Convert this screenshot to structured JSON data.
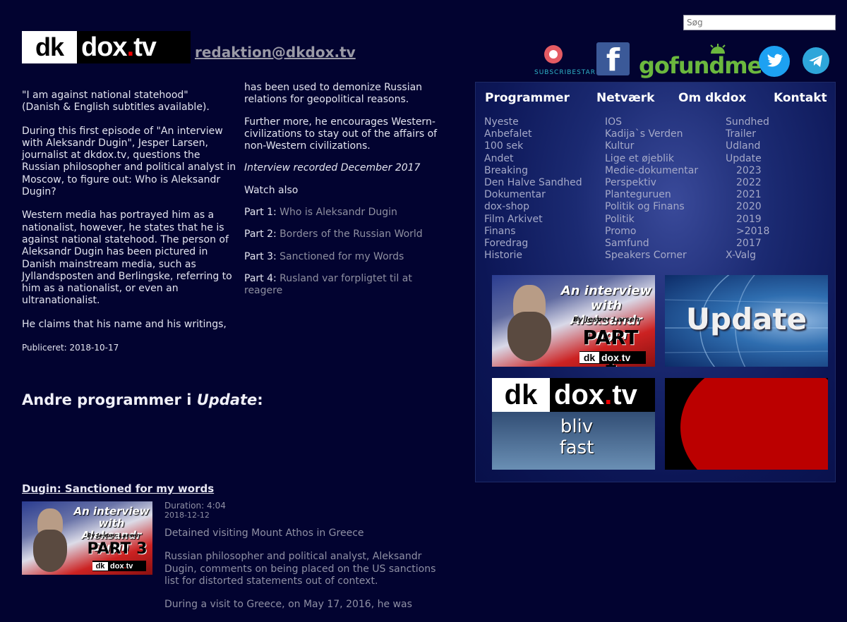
{
  "search": {
    "placeholder": "Søg"
  },
  "header": {
    "logo_dk": "dk",
    "logo_dox": "dox",
    "logo_dot": ".",
    "logo_tv": "tv",
    "email": "redaktion@dkdox.tv"
  },
  "social": {
    "subscribestar_label": "SUBSCRIBESTAR",
    "facebook_glyph": "f",
    "gofundme_label": "gofundme",
    "twitter_icon": "twitter-icon",
    "telegram_icon": "telegram-icon"
  },
  "article": {
    "col1": [
      "\"I am against national statehood\"\n(Danish & English subtitles available).",
      "During this first episode of \"An interview with Aleksandr Dugin\", Jesper Larsen, journalist at dkdox.tv, questions the Russian philosopher and political analyst in Moscow, to figure out: Who is Aleksandr Dugin?",
      "Western media has portrayed him as a nationalist, however, he states that he is against national statehood. The person of Aleksandr Dugin has been pictured in Danish mainstream media, such as Jyllandsposten and Berlingske, referring to him as a nationalist, or even an ultranationalist.",
      "He claims that his name and his writings,"
    ],
    "published": "Publiceret: 2018-10-17",
    "col2_p1": "has been used to demonize Russian relations for geopolitical reasons.",
    "col2_p2": "Further more, he encourages Western-civilizations to stay out of the affairs of non-Western civilizations.",
    "recorded": "Interview recorded December 2017",
    "watch_also": "Watch also",
    "parts": [
      {
        "prefix": "Part 1: ",
        "link": "Who is Aleksandr Dugin"
      },
      {
        "prefix": "Part 2: ",
        "link": "Borders of the Russian World"
      },
      {
        "prefix": "Part 3: ",
        "link": "Sanctioned for my Words"
      },
      {
        "prefix": "Part 4: ",
        "link": "Rusland var forpligtet til at reagere"
      }
    ]
  },
  "andre": {
    "prefix": "Andre programmer i ",
    "italic": "Update",
    "suffix": ":"
  },
  "nav": [
    "Programmer",
    "Netværk",
    "Om dkdox",
    "Kontakt"
  ],
  "menu": {
    "col1": [
      "Nyeste",
      "Anbefalet",
      "100 sek",
      "Andet",
      "Breaking",
      "Den Halve Sandhed",
      "Dokumentar",
      "dox-shop",
      "Film Arkivet",
      "Finans",
      "Foredrag",
      "Historie"
    ],
    "col2": [
      "IOS",
      "Kadija`s Verden",
      "Kultur",
      "Lige et øjeblik",
      "Medie-dokumentar",
      "Perspektiv",
      "Planteguruen",
      "Politik og Finans",
      "Politik",
      "Promo",
      "Samfund",
      "Speakers Corner"
    ],
    "col3": [
      "Sundhed",
      "Trailer",
      "Udland",
      "Update",
      "2023",
      "2022",
      "2021",
      "2020",
      "2019",
      ">2018",
      "2017",
      "X-Valg"
    ]
  },
  "thumbs": {
    "t1_title": "An interview with Aleksandr Dugin",
    "t1_by": "By Jesper Larsen",
    "t1_part": "PART 1",
    "t2_title": "Update",
    "t3_sub": "bliv fast"
  },
  "program": {
    "title": "Dugin: Sanctioned for my words",
    "thumb_title": "An interview with Aleksandr Dugin",
    "thumb_by": "By Jesper Larsen",
    "thumb_part": "PART 3",
    "duration": "Duration: 4:04",
    "date": "2018-12-12",
    "desc": [
      "Detained visiting Mount Athos in Greece",
      "Russian philosopher and political analyst, Aleksandr Dugin, comments on being placed on the US sanctions list for distorted statements out of context.",
      "During a visit to Greece, on May 17, 2016, he was"
    ]
  }
}
